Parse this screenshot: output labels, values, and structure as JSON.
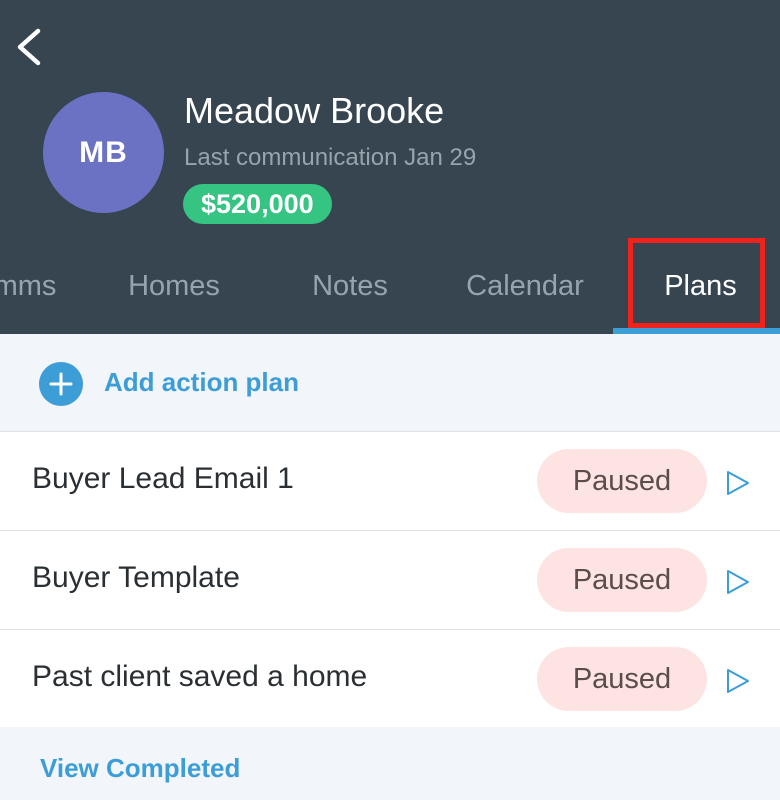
{
  "header": {
    "back_icon": "chevron-left-icon",
    "avatar_initials": "MB",
    "contact_name": "Meadow Brooke",
    "last_communication": "Last communication Jan 29",
    "value": "$520,000"
  },
  "tabs": [
    {
      "label": "mms",
      "active": false
    },
    {
      "label": "Homes",
      "active": false
    },
    {
      "label": "Notes",
      "active": false
    },
    {
      "label": "Calendar",
      "active": false
    },
    {
      "label": "Plans",
      "active": true
    }
  ],
  "add_action_plan": {
    "icon": "plus-icon",
    "label": "Add action plan"
  },
  "plans": [
    {
      "name": "Buyer Lead Email 1",
      "status": "Paused",
      "action_icon": "play-icon"
    },
    {
      "name": "Buyer Template",
      "status": "Paused",
      "action_icon": "play-icon"
    },
    {
      "name": "Past client saved a home",
      "status": "Paused",
      "action_icon": "play-icon"
    }
  ],
  "view_completed_label": "View Completed",
  "colors": {
    "header_bg": "#36454f",
    "accent": "#3d9dd6",
    "value_badge": "#35c482",
    "avatar": "#6b72c4",
    "paused_pill": "#fde3e1",
    "highlight": "#f0221c"
  }
}
